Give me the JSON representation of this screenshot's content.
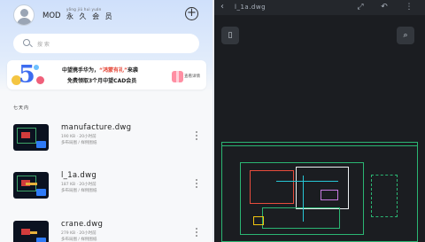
{
  "user": {
    "name": "MOD",
    "pinyin": "yǒng jiǔ huì yuán",
    "membership": "永 久 会 员"
  },
  "search": {
    "placeholder": "搜 索"
  },
  "banner": {
    "line1_prefix": "中望携手华为，",
    "line1_highlight": "“鸿蒙有礼”",
    "line1_suffix": "来袭",
    "line2": "免费领取3个月中望CAD会员",
    "detail_label": "查看详情"
  },
  "section_title": "七天内",
  "files": [
    {
      "name": "manufacture.dwg",
      "meta": "190 KB  · 20小时前",
      "tags": "多布局图 / 样例图纸"
    },
    {
      "name": "l_1a.dwg",
      "meta": "187 KB  · 20小时前",
      "tags": "多布局图 / 样例图纸"
    },
    {
      "name": "crane.dwg",
      "meta": "279 KB  · 20小时前",
      "tags": "多布局图 / 样例图纸"
    }
  ],
  "viewer": {
    "title": "l_1a.dwg",
    "icons": [
      "back-icon",
      "fullscreen-icon",
      "undo-icon",
      "more-icon",
      "layout-icon",
      "zoom-icon"
    ]
  },
  "colors": {
    "accent": "#3d6cf0",
    "highlight": "#e54b3c",
    "viewer_bg": "#1b1d21",
    "cad_green": "#2bb673"
  }
}
